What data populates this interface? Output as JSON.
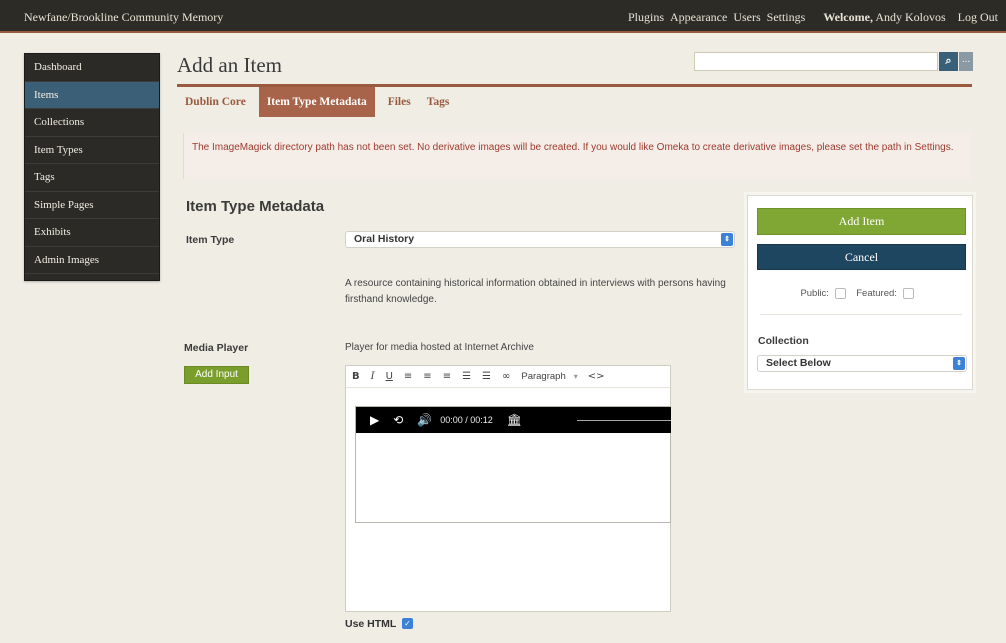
{
  "topbar": {
    "site_title": "Newfane/Brookline Community Memory",
    "nav": [
      "Plugins",
      "Appearance",
      "Users",
      "Settings"
    ],
    "welcome_prefix": "Welcome,",
    "welcome_user": "Andy Kolovos",
    "logout": "Log Out"
  },
  "sidebar": {
    "items": [
      {
        "label": "Dashboard"
      },
      {
        "label": "Items"
      },
      {
        "label": "Collections"
      },
      {
        "label": "Item Types"
      },
      {
        "label": "Tags"
      },
      {
        "label": "Simple Pages"
      },
      {
        "label": "Exhibits"
      },
      {
        "label": "Admin Images"
      }
    ],
    "active": "Items"
  },
  "page": {
    "title": "Add an Item"
  },
  "search": {
    "value": "",
    "button_icon": "search-icon",
    "more_label": "..."
  },
  "tabs": [
    "Dublin Core",
    "Item Type Metadata",
    "Files",
    "Tags"
  ],
  "active_tab": "Item Type Metadata",
  "notice": "The ImageMagick directory path has not been set. No derivative images will be created. If you would like Omeka to create derivative images, please set the path in Settings.",
  "metadata": {
    "section_title": "Item Type Metadata",
    "item_type_label": "Item Type",
    "item_type_value": "Oral History",
    "item_type_description": "A resource containing historical information obtained in interviews with persons having firsthand knowledge.",
    "media_player_label": "Media Player",
    "media_player_description": "Player for media hosted at Internet Archive",
    "add_input_label": "Add Input",
    "editor": {
      "toolbar": [
        "B",
        "I",
        "U",
        "≡",
        "≡",
        "≡",
        "☰",
        "☰",
        "🔗"
      ],
      "format_label": "Paragraph",
      "code_label": "<>",
      "player_time": "00:00 / 00:12"
    },
    "use_html_label": "Use HTML",
    "use_html_checked": true
  },
  "actions": {
    "add_item": "Add Item",
    "cancel": "Cancel",
    "public_label": "Public:",
    "featured_label": "Featured:",
    "collection_label": "Collection",
    "collection_value": "Select Below"
  },
  "colors": {
    "accent": "#9a5a3f",
    "nav_active": "#3c5f78",
    "add_button": "#80a633",
    "cancel_button": "#1f4660",
    "notice_text": "#9e3a2e"
  }
}
